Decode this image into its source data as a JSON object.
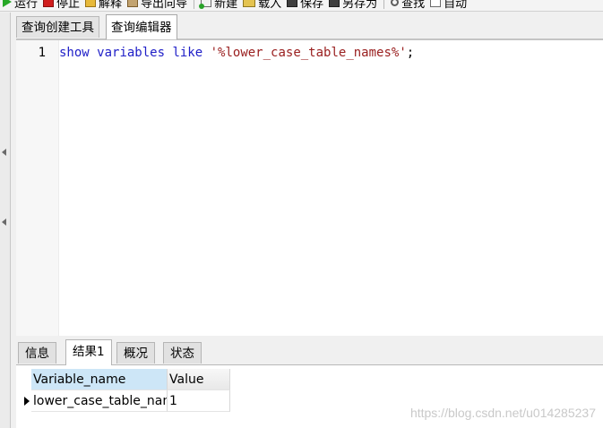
{
  "toolbar": {
    "buttons": [
      {
        "label": "运行",
        "icon": "play-icon"
      },
      {
        "label": "停止",
        "icon": "stop-icon"
      },
      {
        "label": "解释",
        "icon": "explain-icon"
      },
      {
        "label": "导出向导",
        "icon": "export-icon"
      },
      {
        "label": "新建",
        "icon": "new-icon"
      },
      {
        "label": "载入",
        "icon": "folder-icon"
      },
      {
        "label": "保存",
        "icon": "save-icon"
      },
      {
        "label": "另存为",
        "icon": "save-as-icon"
      },
      {
        "label": "查找",
        "icon": "search-icon"
      },
      {
        "label": "自动",
        "icon": "autocomplete-icon"
      }
    ]
  },
  "tabs": [
    {
      "label": "查询创建工具",
      "active": false
    },
    {
      "label": "查询编辑器",
      "active": true
    }
  ],
  "editor": {
    "line_number": "1",
    "tokens": {
      "kw1": "show",
      "kw2": "variables",
      "kw3": "like",
      "str": "'%lower_case_table_names%'",
      "end": ";"
    }
  },
  "result_tabs": [
    {
      "label": "信息",
      "active": false
    },
    {
      "label": "结果1",
      "active": true
    },
    {
      "label": "概况",
      "active": false
    },
    {
      "label": "状态",
      "active": false
    }
  ],
  "grid": {
    "columns": [
      "Variable_name",
      "Value"
    ],
    "rows": [
      [
        "lower_case_table_names",
        "1"
      ]
    ]
  },
  "watermark": "https://blog.csdn.net/u014285237"
}
